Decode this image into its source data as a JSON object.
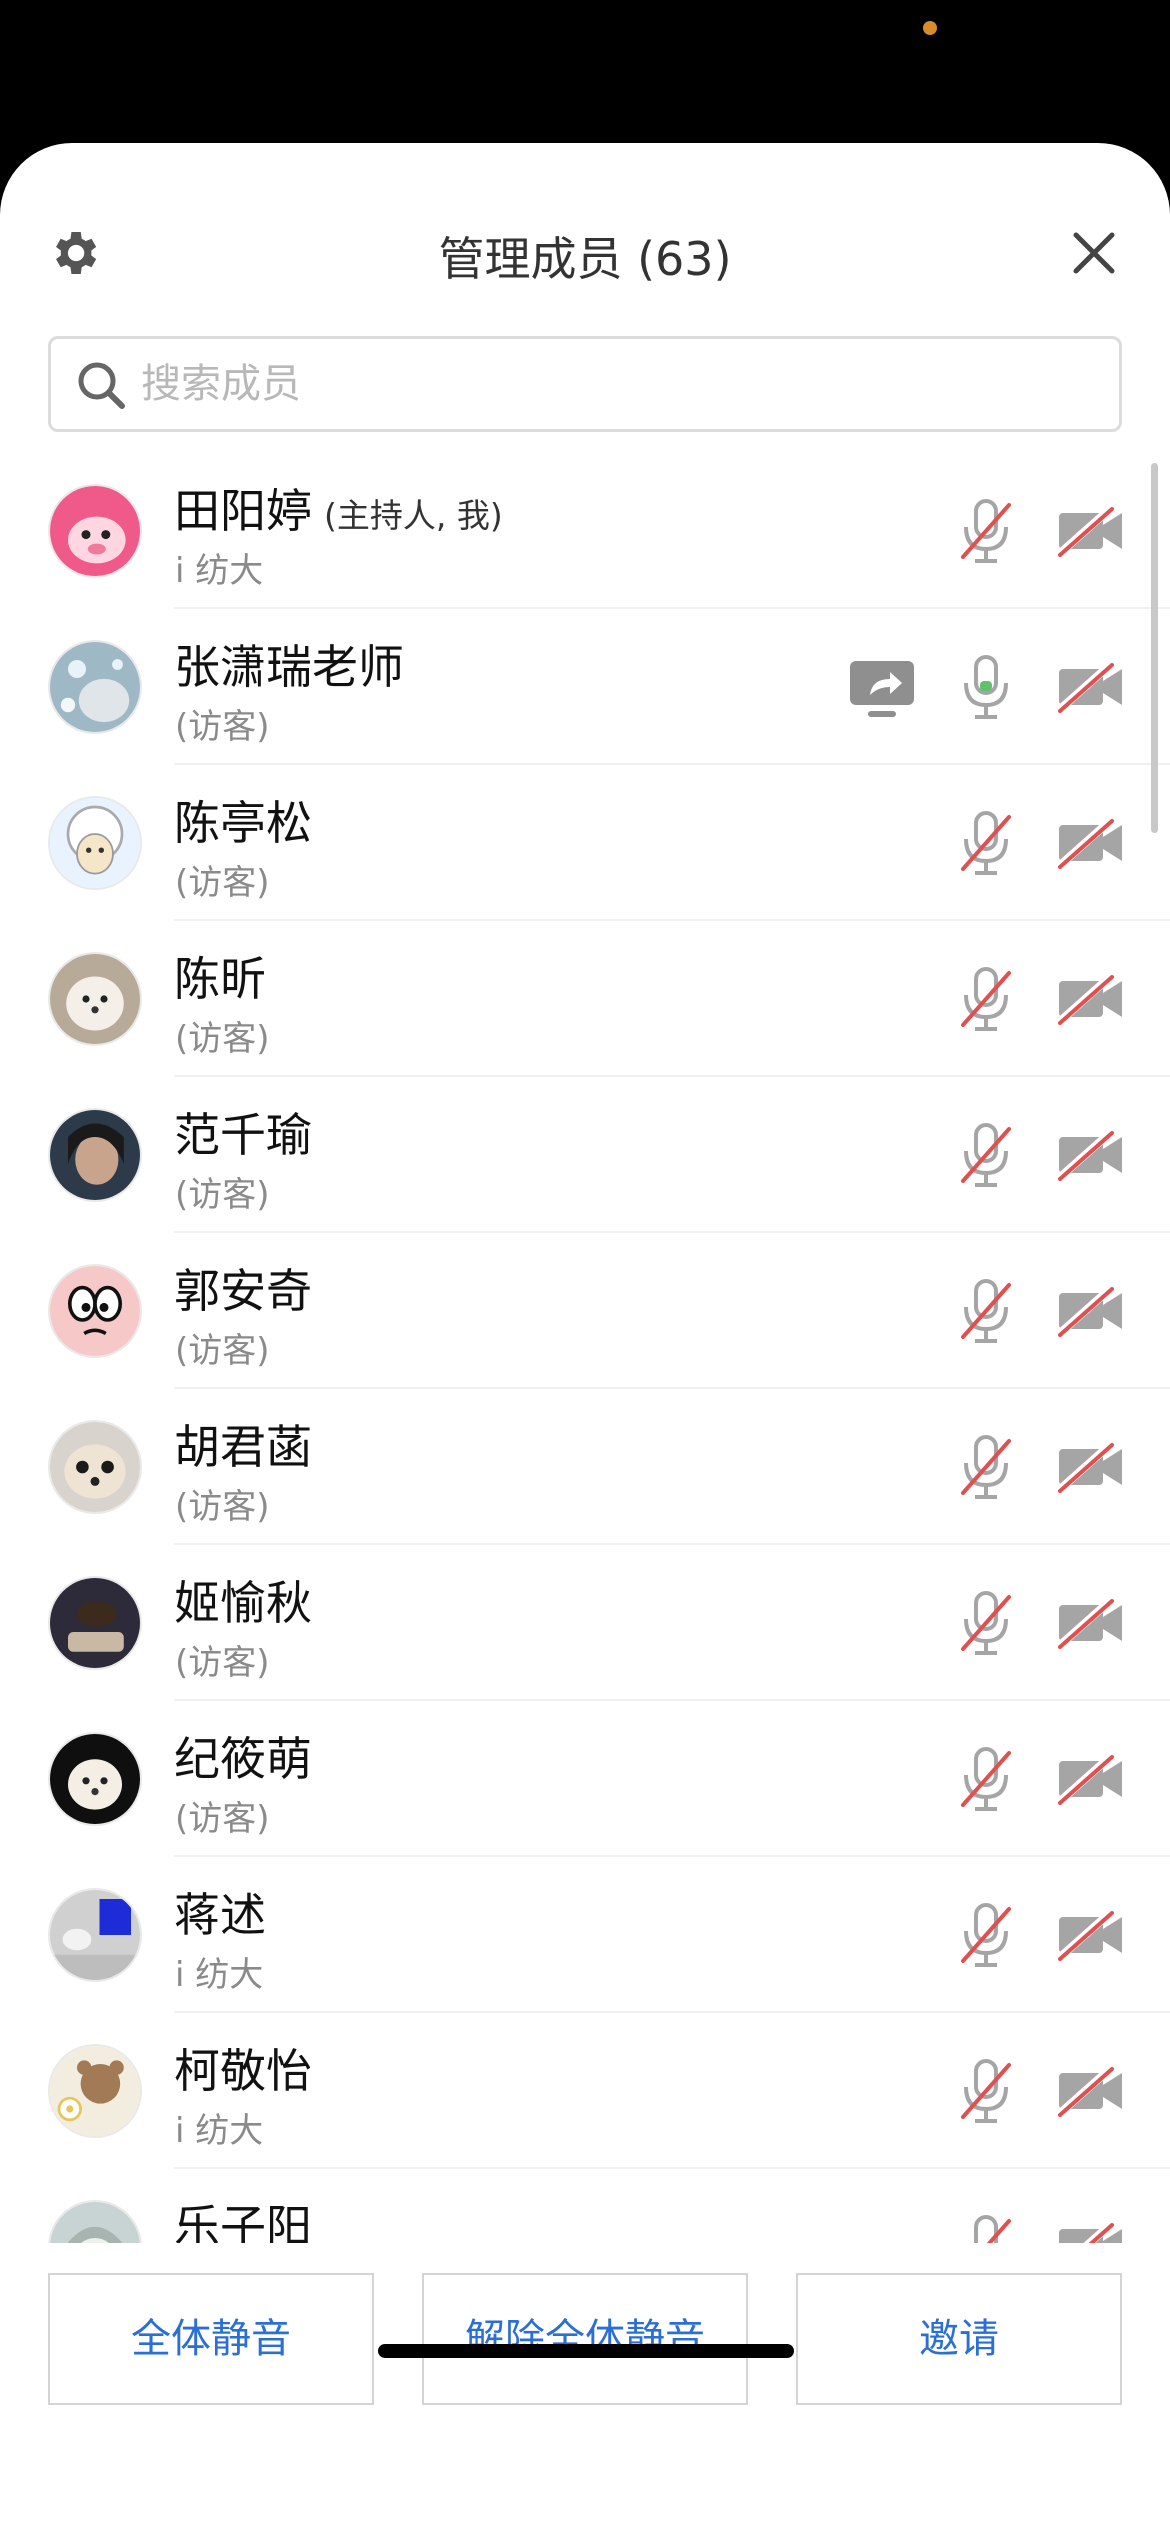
{
  "header": {
    "title": "管理成员 (63)"
  },
  "search": {
    "placeholder": "搜索成员"
  },
  "members": [
    {
      "name": "田阳婷",
      "role": "(主持人, 我)",
      "sub": "i 纺大",
      "mic": "muted",
      "cam": "off",
      "avatar": "pink-cartoon"
    },
    {
      "name": "张潇瑞老师",
      "role": "",
      "sub": "(访客)",
      "mic": "on",
      "cam": "off",
      "sharing": true,
      "avatar": "snow-cat"
    },
    {
      "name": "陈亭松",
      "role": "",
      "sub": "(访客)",
      "mic": "muted",
      "cam": "off",
      "avatar": "sheep-cartoon"
    },
    {
      "name": "陈昕",
      "role": "",
      "sub": "(访客)",
      "mic": "muted",
      "cam": "off",
      "avatar": "white-dog"
    },
    {
      "name": "范千瑜",
      "role": "",
      "sub": "(访客)",
      "mic": "muted",
      "cam": "off",
      "avatar": "girl-photo"
    },
    {
      "name": "郭安奇",
      "role": "",
      "sub": "(访客)",
      "mic": "muted",
      "cam": "off",
      "avatar": "face-cartoon"
    },
    {
      "name": "胡君菡",
      "role": "",
      "sub": "(访客)",
      "mic": "muted",
      "cam": "off",
      "avatar": "chihuahua"
    },
    {
      "name": "姬愉秋",
      "role": "",
      "sub": "(访客)",
      "mic": "muted",
      "cam": "off",
      "avatar": "coffee-photo"
    },
    {
      "name": "纪筱萌",
      "role": "",
      "sub": "(访客)",
      "mic": "muted",
      "cam": "off",
      "avatar": "puppy-dark"
    },
    {
      "name": "蒋述",
      "role": "",
      "sub": "i 纺大",
      "mic": "muted",
      "cam": "off",
      "avatar": "room-photo"
    },
    {
      "name": "柯敬怡",
      "role": "",
      "sub": "i 纺大",
      "mic": "muted",
      "cam": "off",
      "avatar": "bear-cartoon"
    },
    {
      "name": "乐子阳",
      "role": "",
      "sub": "",
      "mic": "muted",
      "cam": "off",
      "avatar": "anime-girl"
    }
  ],
  "footer": {
    "mute_all": "全体静音",
    "unmute_all": "解除全体静音",
    "invite": "邀请"
  },
  "colors": {
    "accent": "#2b6fd6",
    "muted_slash": "#e05050",
    "icon_gray": "#a5a5a5",
    "mic_level": "#5cc36b"
  }
}
